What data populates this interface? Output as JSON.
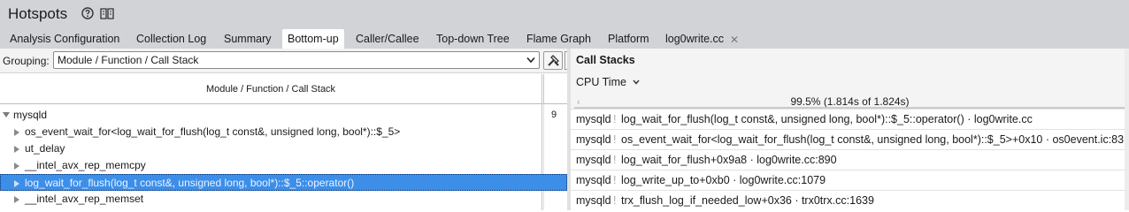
{
  "window": {
    "title": "Hotspots"
  },
  "tabs": [
    {
      "label": "Analysis Configuration",
      "active": false
    },
    {
      "label": "Collection Log",
      "active": false
    },
    {
      "label": "Summary",
      "active": false
    },
    {
      "label": "Bottom-up",
      "active": true
    },
    {
      "label": "Caller/Callee",
      "active": false
    },
    {
      "label": "Top-down Tree",
      "active": false
    },
    {
      "label": "Flame Graph",
      "active": false
    },
    {
      "label": "Platform",
      "active": false
    },
    {
      "label": "log0write.cc",
      "active": false,
      "closable": true
    }
  ],
  "close_glyph": "✕",
  "grouping": {
    "label": "Grouping:",
    "value": "Module / Function / Call Stack"
  },
  "grid": {
    "column_header": "Module / Function / Call Stack",
    "rows": [
      {
        "label": "mysqld",
        "level": 0,
        "expanded": true,
        "value": "9",
        "selected": false
      },
      {
        "label": "os_event_wait_for<log_wait_for_flush(log_t const&, unsigned long, bool*)::$_5>",
        "level": 1,
        "expanded": false,
        "value": "",
        "selected": false
      },
      {
        "label": "ut_delay",
        "level": 1,
        "expanded": false,
        "value": "",
        "selected": false
      },
      {
        "label": "__intel_avx_rep_memcpy",
        "level": 1,
        "expanded": false,
        "value": "",
        "selected": false
      },
      {
        "label": "log_wait_for_flush(log_t const&, unsigned long, bool*)::$_5::operator()",
        "level": 1,
        "expanded": false,
        "value": "",
        "selected": true
      },
      {
        "label": "__intel_avx_rep_memset",
        "level": 1,
        "expanded": false,
        "value": "",
        "selected": false
      }
    ]
  },
  "call_stacks": {
    "title": "Call Stacks",
    "metric": "CPU Time",
    "nav_left": "‹",
    "percent_text": "99.5% (1.814s of 1.824s)",
    "percent": 99.5,
    "separator": "!",
    "frames": [
      {
        "module": "mysqld",
        "frame": "log_wait_for_flush(log_t const&, unsigned long, bool*)::$_5::operator() · log0write.cc"
      },
      {
        "module": "mysqld",
        "frame": "os_event_wait_for<log_wait_for_flush(log_t const&, unsigned long, bool*)::$_5>+0x10 · os0event.ic:83"
      },
      {
        "module": "mysqld",
        "frame": "log_wait_for_flush+0x9a8 · log0write.cc:890"
      },
      {
        "module": "mysqld",
        "frame": "log_write_up_to+0xb0 · log0write.cc:1079"
      },
      {
        "module": "mysqld",
        "frame": "trx_flush_log_if_needed_low+0x36 · trx0trx.cc:1639"
      }
    ]
  },
  "colors": {
    "chrome": "#d2d3d7",
    "selection": "#3d8ee8",
    "panel": "#f4f4f4"
  }
}
